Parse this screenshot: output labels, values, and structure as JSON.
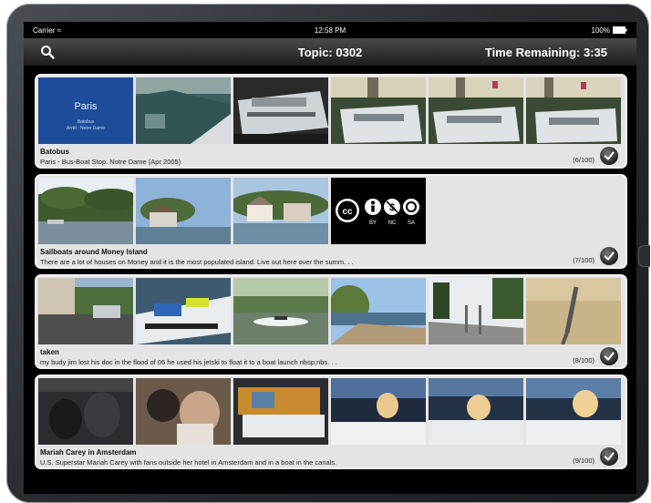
{
  "status_bar": {
    "carrier": "Carrier",
    "time": "12:58 PM",
    "battery": "100%"
  },
  "nav": {
    "topic": "Topic: 0302",
    "time_remaining": "Time Remaining: 3:35"
  },
  "cards": [
    {
      "title": "Batobus",
      "description": "Paris - Bus-Boat Stop. Notre Dame (Apr 2005)",
      "count": "(6/100)",
      "thumb_text": {
        "city": "Paris",
        "line1": "Batobus",
        "line2": "Arrêt : Notre Dame"
      }
    },
    {
      "title": "Sailboats around Money Island",
      "description": "There are a lot of houses on Money and it is the most populated island. Live out here over the summ. . .",
      "count": "(7/100)",
      "license": [
        "BY",
        "NC",
        "SA"
      ]
    },
    {
      "title": "taken",
      "description": "my budy jim lost his doc in the flood of 06 he used his jetski to float it to a boat launch nbsp;nbs. . .",
      "count": "(8/100)"
    },
    {
      "title": "Mariah Carey in Amsterdam",
      "description": "U.S. Superstar Mariah Carey with fans outside her hotel in Amsterdam and in a boat in the canals.",
      "count": "(9/100)"
    }
  ]
}
